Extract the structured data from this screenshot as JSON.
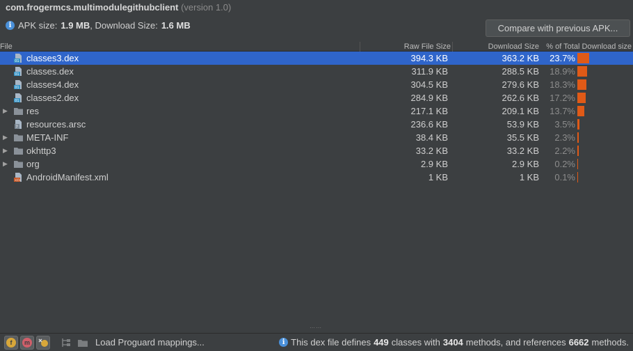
{
  "header": {
    "package_name": "com.frogermcs.multimodulegithubclient",
    "version": "(version 1.0)",
    "apk_size_label": "APK size:",
    "apk_size_value": "1.9 MB",
    "download_size_label": ", Download Size:",
    "download_size_value": "1.6 MB",
    "compare_button": "Compare with previous APK..."
  },
  "table": {
    "columns": {
      "file": "File",
      "raw": "Raw File Size",
      "download": "Download Size",
      "percent": "% of Total Download size"
    },
    "rows": [
      {
        "name": "classes3.dex",
        "raw": "394.3 KB",
        "dl": "363.2 KB",
        "pct": "23.7%",
        "share": 23.7,
        "icon": "dex-file-icon",
        "expandable": false,
        "selected": true
      },
      {
        "name": "classes.dex",
        "raw": "311.9 KB",
        "dl": "288.5 KB",
        "pct": "18.9%",
        "share": 18.9,
        "icon": "dex-file-icon",
        "expandable": false,
        "selected": false
      },
      {
        "name": "classes4.dex",
        "raw": "304.5 KB",
        "dl": "279.6 KB",
        "pct": "18.3%",
        "share": 18.3,
        "icon": "dex-file-icon",
        "expandable": false,
        "selected": false
      },
      {
        "name": "classes2.dex",
        "raw": "284.9 KB",
        "dl": "262.6 KB",
        "pct": "17.2%",
        "share": 17.2,
        "icon": "dex-file-icon",
        "expandable": false,
        "selected": false
      },
      {
        "name": "res",
        "raw": "217.1 KB",
        "dl": "209.1 KB",
        "pct": "13.7%",
        "share": 13.7,
        "icon": "folder-icon",
        "expandable": true,
        "selected": false
      },
      {
        "name": "resources.arsc",
        "raw": "236.6 KB",
        "dl": "53.9 KB",
        "pct": "3.5%",
        "share": 3.5,
        "icon": "unknown-file-icon",
        "expandable": false,
        "selected": false
      },
      {
        "name": "META-INF",
        "raw": "38.4 KB",
        "dl": "35.5 KB",
        "pct": "2.3%",
        "share": 2.3,
        "icon": "folder-icon",
        "expandable": true,
        "selected": false
      },
      {
        "name": "okhttp3",
        "raw": "33.2 KB",
        "dl": "33.2 KB",
        "pct": "2.2%",
        "share": 2.2,
        "icon": "folder-icon",
        "expandable": true,
        "selected": false
      },
      {
        "name": "org",
        "raw": "2.9 KB",
        "dl": "2.9 KB",
        "pct": "0.2%",
        "share": 0.2,
        "icon": "folder-icon",
        "expandable": true,
        "selected": false
      },
      {
        "name": "AndroidManifest.xml",
        "raw": "1 KB",
        "dl": "1 KB",
        "pct": "0.1%",
        "share": 0.1,
        "icon": "xml-file-icon",
        "expandable": false,
        "selected": false
      }
    ]
  },
  "status": {
    "load_proguard": "Load Proguard mappings...",
    "dex_prefix": "This dex file defines",
    "classes_count": "449",
    "classes_word": "classes with",
    "methods_count": "3404",
    "methods_word": "methods, and references",
    "ref_count": "6662",
    "ref_word": "methods."
  },
  "colors": {
    "background": "#3c3f41",
    "selection": "#2f65ca",
    "bar": "#e05a17",
    "info": "#4a90d9"
  }
}
